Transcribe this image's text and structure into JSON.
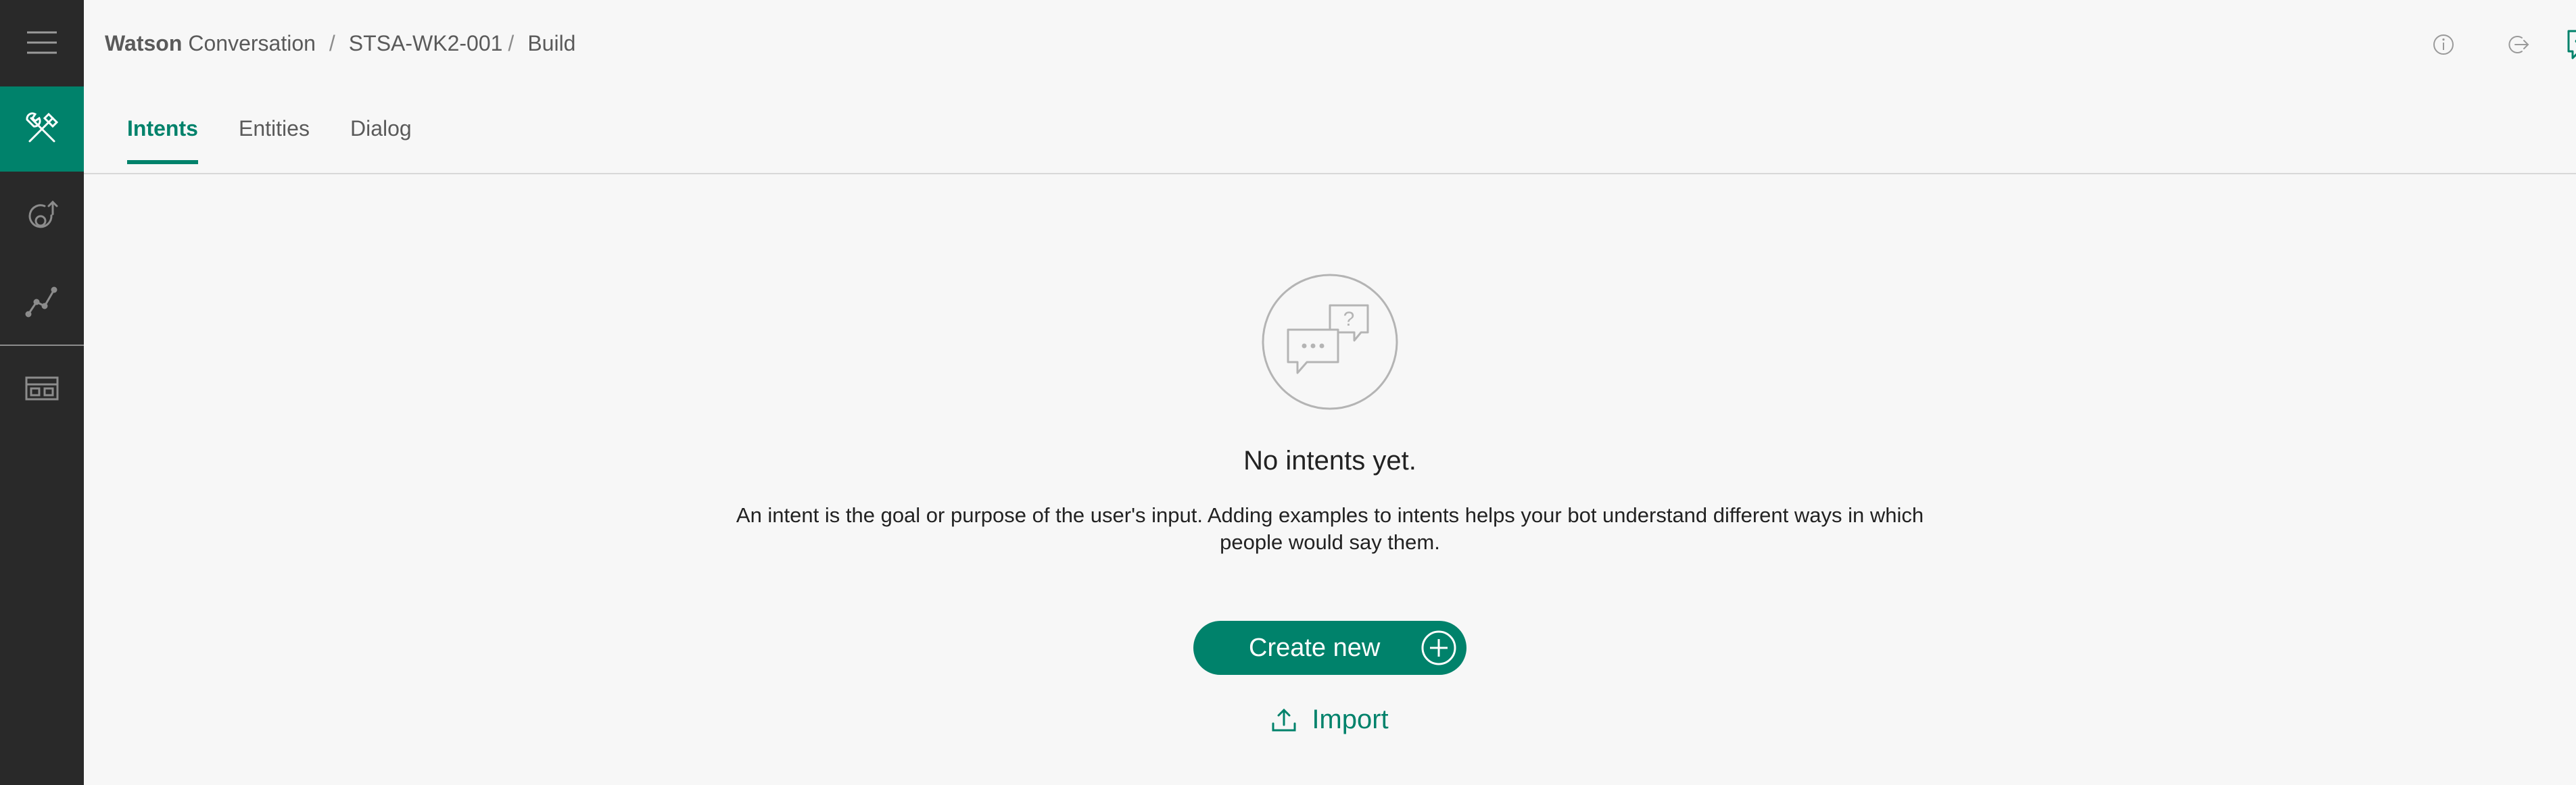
{
  "app": {
    "brand": "Watson",
    "product": "Conversation",
    "breadcrumb_sep": "/",
    "workspace": "STSA-WK2-001",
    "workspace_sep": "/",
    "page": "Build"
  },
  "sidebar": {
    "items": [
      {
        "icon": "menu-icon"
      },
      {
        "icon": "build-tools-icon",
        "active": true
      },
      {
        "icon": "improve-icon"
      },
      {
        "icon": "analytics-icon"
      },
      {
        "icon": "workspaces-icon"
      }
    ]
  },
  "header_icons": [
    "info-icon",
    "exit-icon",
    "chat-icon"
  ],
  "tabs": [
    {
      "label": "Intents",
      "active": true
    },
    {
      "label": "Entities"
    },
    {
      "label": "Dialog"
    }
  ],
  "empty_state": {
    "title": "No intents yet.",
    "description_line1": "An intent is the goal or purpose of the user's input. Adding examples to intents helps your bot understand different ways in which",
    "description_line2": "people would say them.",
    "create_label": "Create new",
    "import_label": "Import"
  },
  "colors": {
    "accent": "#00826b",
    "sidebar": "#292929",
    "background": "#f7f7f7"
  }
}
